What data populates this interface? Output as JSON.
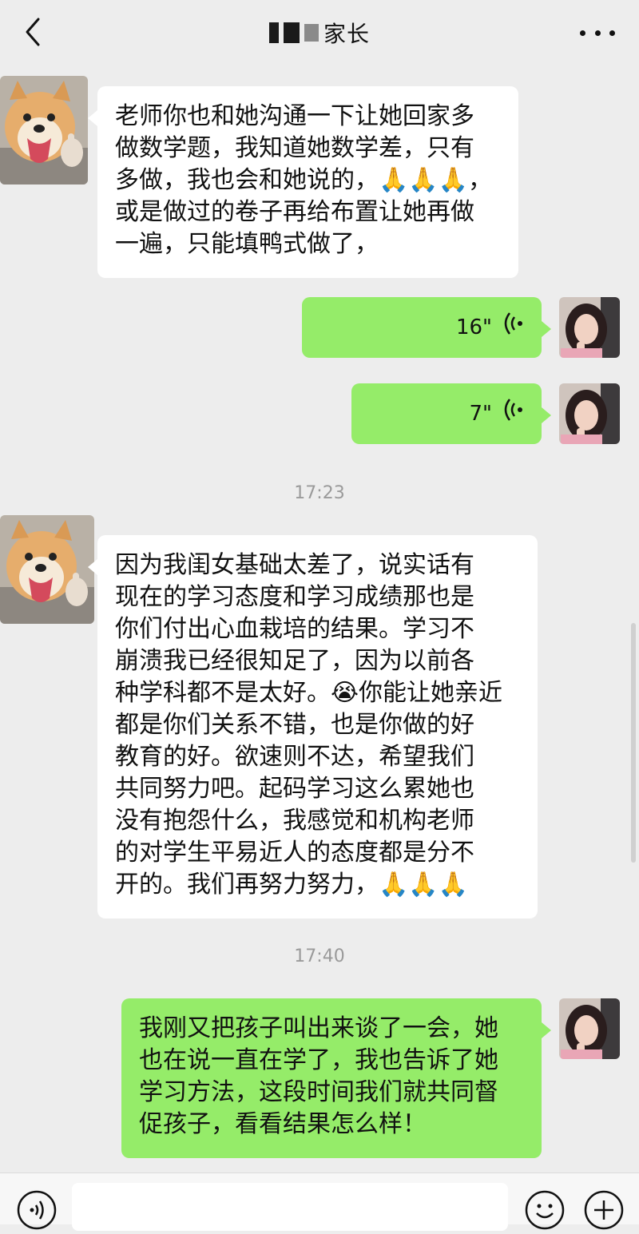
{
  "header": {
    "back_icon": "chevron-left-icon",
    "contact_name_suffix": "家长",
    "more_icon": "more-dots-icon"
  },
  "messages": [
    {
      "id": "m1",
      "direction": "incoming",
      "avatar": "shiba-dog-avatar",
      "text": "老师你也和她沟通一下让她回家多\n做数学题，我知道她数学差，只有\n多做，我也会和她说的，🙏🙏🙏，\n或是做过的卷子再给布置让她再做\n一遍，只能填鸭式做了，"
    },
    {
      "id": "m2",
      "direction": "outgoing",
      "type": "voice",
      "avatar": "woman-avatar",
      "duration": "16\""
    },
    {
      "id": "m3",
      "direction": "outgoing",
      "type": "voice",
      "avatar": "woman-avatar",
      "duration": "7\""
    },
    {
      "id": "t1",
      "type": "timestamp",
      "text": "17:23"
    },
    {
      "id": "m4",
      "direction": "incoming",
      "avatar": "shiba-dog-avatar",
      "text": "因为我闺女基础太差了，说实话有\n现在的学习态度和学习成绩那也是\n你们付出心血栽培的结果。学习不\n崩溃我已经很知足了，因为以前各\n种学科都不是太好。😭你能让她亲近\n都是你们关系不错，也是你做的好\n教育的好。欲速则不达，希望我们\n共同努力吧。起码学习这么累她也\n没有抱怨什么，我感觉和机构老师\n的对学生平易近人的态度都是分不\n开的。我们再努力努力，🙏🙏🙏"
    },
    {
      "id": "t2",
      "type": "timestamp",
      "text": "17:40"
    },
    {
      "id": "m5",
      "direction": "outgoing",
      "avatar": "woman-avatar",
      "text": "我刚又把孩子叫出来谈了一会，她\n也在说一直在学了，我也告诉了她\n学习方法，这段时间我们就共同督\n促孩子，看看结果怎么样！"
    }
  ],
  "bottom_bar": {
    "voice_icon": "voice-input-icon",
    "emoji_icon": "emoji-icon",
    "plus_icon": "plus-icon",
    "input_value": ""
  },
  "colors": {
    "background": "#ededed",
    "incoming_bubble": "#ffffff",
    "outgoing_bubble": "#95ec69",
    "timestamp_text": "#9a9a9a"
  }
}
